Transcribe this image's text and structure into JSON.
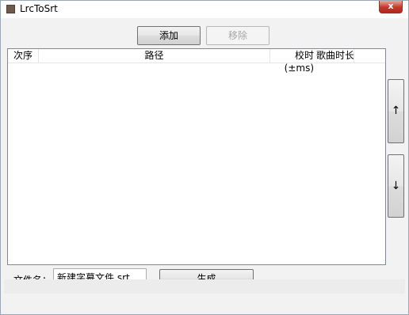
{
  "window": {
    "title": "LrcToSrt",
    "close_glyph": "x"
  },
  "toolbar": {
    "add_label": "添加",
    "remove_label": "移除"
  },
  "list": {
    "columns": [
      "次序",
      "路径",
      "校时(±ms)",
      "歌曲时长"
    ]
  },
  "side_buttons": {
    "up_label": "↑",
    "down_label": "↓"
  },
  "footer": {
    "filename_label": "文件名：",
    "filename_value": "新建字幕文件.srt",
    "generate_label": "生成"
  }
}
